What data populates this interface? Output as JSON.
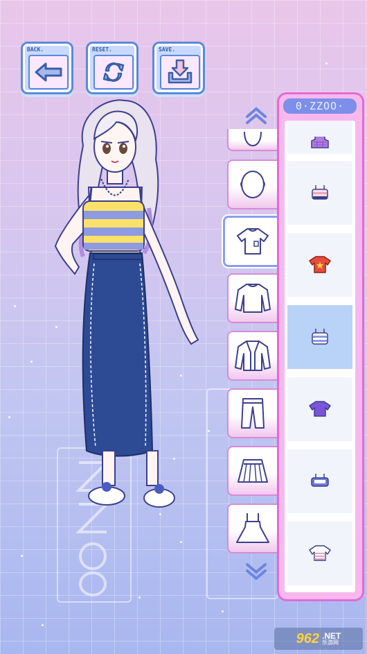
{
  "top_buttons": {
    "back": {
      "label": "BACK.",
      "icon": "arrow-left-icon"
    },
    "reset": {
      "label": "RESET.",
      "icon": "refresh-icon"
    },
    "save": {
      "label": "SAVE.",
      "icon": "download-icon"
    }
  },
  "panel": {
    "title": "0·ZZOO·",
    "items": [
      {
        "name": "purple-crop-top",
        "color": "#b27de0"
      },
      {
        "name": "pink-striped-bandeau",
        "color": "#f0a6b8"
      },
      {
        "name": "red-star-tee",
        "color": "#e64b3c"
      },
      {
        "name": "striped-cami",
        "color": "#8d9ad8",
        "selected": true
      },
      {
        "name": "purple-tee",
        "color": "#7a55d9"
      },
      {
        "name": "blue-logo-tube",
        "color": "#6f78d8"
      },
      {
        "name": "striped-tee",
        "color": "#d8a3c6"
      }
    ]
  },
  "categories": [
    {
      "name": "face",
      "icon": "face-icon"
    },
    {
      "name": "head",
      "icon": "head-icon"
    },
    {
      "name": "tops",
      "icon": "tshirt-icon",
      "active": true
    },
    {
      "name": "long-sleeve",
      "icon": "longsleeve-icon"
    },
    {
      "name": "jacket",
      "icon": "jacket-icon"
    },
    {
      "name": "pants",
      "icon": "pants-icon"
    },
    {
      "name": "skirt",
      "icon": "skirt-icon"
    },
    {
      "name": "dress",
      "icon": "dress-icon"
    }
  ],
  "background_text": "ZZOO",
  "watermark": {
    "number": "962",
    "suffix": ".NET",
    "subtitle": "乐游网"
  },
  "colors": {
    "panel_border": "#e36bd2",
    "panel_bg": "#f7b8ee",
    "title_bg": "#7d8fe8",
    "button_border": "#5a8ad8",
    "active_tab": "#8a9ef0"
  }
}
